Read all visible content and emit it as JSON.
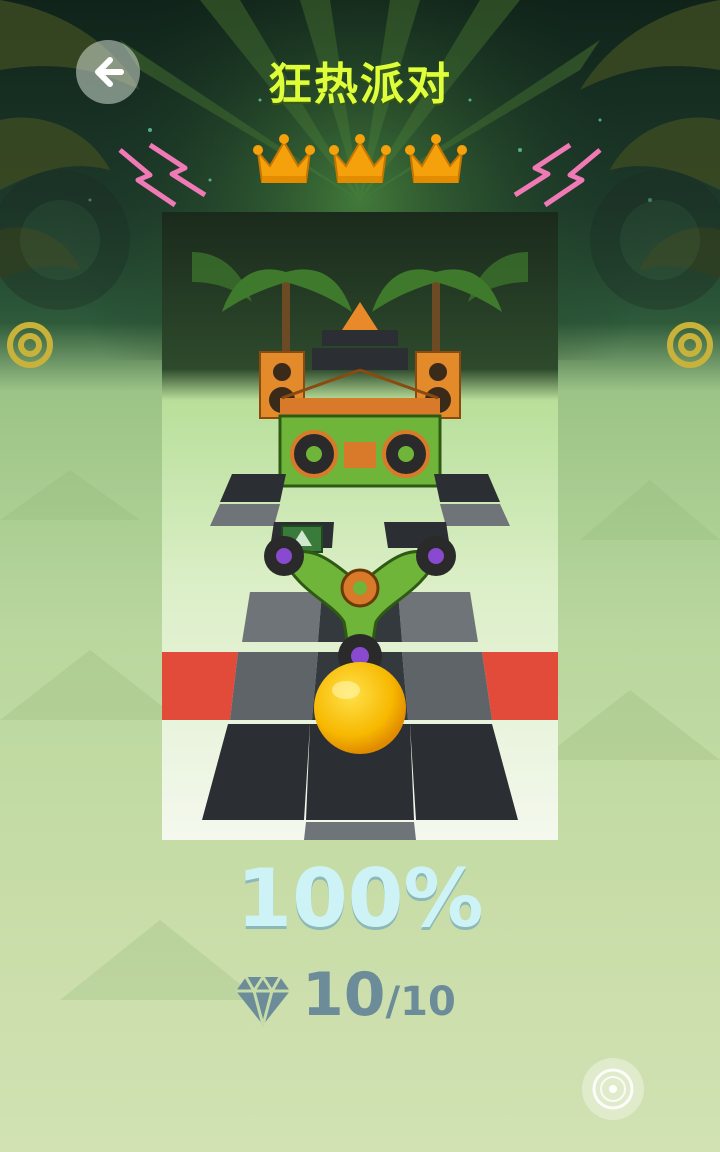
{
  "level": {
    "title": "狂热派对",
    "crowns_earned": 3,
    "crowns_total": 3
  },
  "result": {
    "progress": "100%",
    "gems_collected": "10",
    "gems_total": "/10"
  },
  "icons": {
    "back": "arrow-left-icon",
    "crown": "crown-icon",
    "gem": "diamond-icon",
    "music": "music-disc-icon"
  },
  "colors": {
    "title": "#dfff3a",
    "crown": "#f5a10c",
    "progress": "#cdf3f6",
    "gems": "#6d8c99",
    "ball": "#f7b800"
  }
}
